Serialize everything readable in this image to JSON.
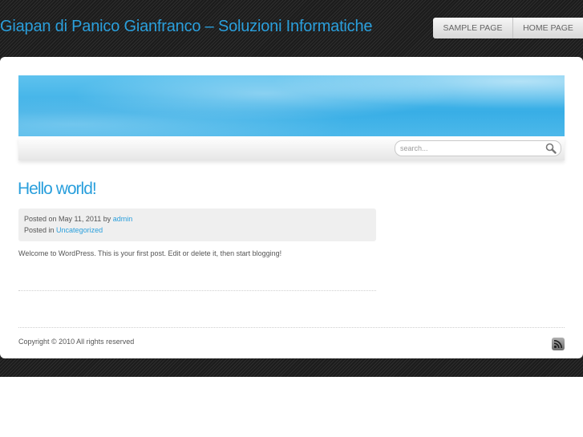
{
  "header": {
    "site_title": "Giapan di Panico Gianfranco – Soluzioni Informatiche",
    "nav": [
      {
        "label": "Sample Page"
      },
      {
        "label": "Home Page"
      }
    ]
  },
  "search": {
    "placeholder": "search...",
    "value": ""
  },
  "post": {
    "title": "Hello world!",
    "posted_on_prefix": "Posted on May 11, 2011 by",
    "author": "admin",
    "posted_in_prefix": "Posted in",
    "category": "Uncategorized",
    "body": "Welcome to WordPress. This is your first post. Edit or delete it, then start blogging!"
  },
  "footer": {
    "copyright": "Copyright © 2010 All rights reserved",
    "rss_icon": "rss-icon"
  },
  "colors": {
    "accent": "#2a9fdc",
    "banner": "#38aee6",
    "background_dark": "#262626"
  }
}
